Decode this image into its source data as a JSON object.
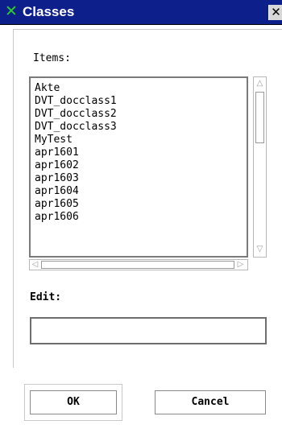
{
  "window": {
    "title": "Classes",
    "icon": "x-logo-icon",
    "close_glyph": "✕"
  },
  "items": {
    "label": "Items:",
    "list": [
      "Akte",
      "DVT_docclass1",
      "DVT_docclass2",
      "DVT_docclass3",
      "MyTest",
      "apr1601",
      "apr1602",
      "apr1603",
      "apr1604",
      "apr1605",
      "apr1606"
    ]
  },
  "edit": {
    "label": "Edit:",
    "value": ""
  },
  "buttons": {
    "ok": "OK",
    "cancel": "Cancel"
  },
  "colors": {
    "titlebar": "#0c1f8a",
    "icon": "#2bd12b"
  }
}
